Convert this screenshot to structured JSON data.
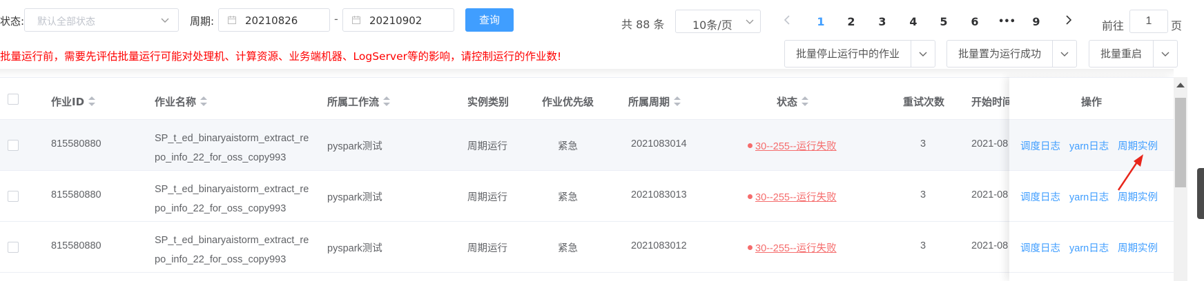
{
  "filters": {
    "status_label": "状态:",
    "status_placeholder": "默认全部状态",
    "period_label": "周期:",
    "date_from": "20210826",
    "date_sep": "-",
    "date_to": "20210902",
    "query_button": "查询"
  },
  "pagination": {
    "total": "共 88 条",
    "page_size": "10条/页",
    "pages": [
      "1",
      "2",
      "3",
      "4",
      "5",
      "6",
      "•••",
      "9"
    ],
    "current_page": "1",
    "goto_label": "前往",
    "goto_value": "1",
    "goto_suffix": "页"
  },
  "warning": "批量运行前，需要先评估批量运行可能对处理机、计算资源、业务端机器、LogServer等的影响，请控制运行的作业数!",
  "batch_actions": {
    "stop": "批量停止运行中的作业",
    "set_success": "批量置为运行成功",
    "rerun": "批量重启"
  },
  "table": {
    "columns": {
      "job_id": "作业ID",
      "job_name": "作业名称",
      "workflow": "所属工作流",
      "instance_type": "实例类别",
      "priority": "作业优先级",
      "period": "所属周期",
      "status": "状态",
      "retries": "重试次数",
      "start_time": "开始时间",
      "operations": "操作"
    },
    "rows": [
      {
        "job_id": "815580880",
        "job_name": "SP_t_ed_binaryaistorm_extract_repo_info_22_for_oss_copy993",
        "workflow": "pyspark测试",
        "instance_type": "周期运行",
        "priority": "紧急",
        "period": "2021083014",
        "status": "30--255--运行失败",
        "retries": "3",
        "start_time": "2021-08"
      },
      {
        "job_id": "815580880",
        "job_name": "SP_t_ed_binaryaistorm_extract_repo_info_22_for_oss_copy993",
        "workflow": "pyspark测试",
        "instance_type": "周期运行",
        "priority": "紧急",
        "period": "2021083013",
        "status": "30--255--运行失败",
        "retries": "3",
        "start_time": "2021-08"
      },
      {
        "job_id": "815580880",
        "job_name": "SP_t_ed_binaryaistorm_extract_repo_info_22_for_oss_copy993",
        "workflow": "pyspark测试",
        "instance_type": "周期运行",
        "priority": "紧急",
        "period": "2021083012",
        "status": "30--255--运行失败",
        "retries": "3",
        "start_time": "2021-08"
      }
    ],
    "row_actions": {
      "schedule_log": "调度日志",
      "yarn_log": "yarn日志",
      "period_instance": "周期实例"
    }
  },
  "colors": {
    "primary": "#409eff",
    "danger": "#f56c6c",
    "warning_text": "#ff0000"
  },
  "icons": [
    "chevron-down-icon",
    "calendar-icon",
    "chevron-left-icon",
    "chevron-right-icon",
    "sort-icon",
    "annotation-arrow-icon"
  ]
}
